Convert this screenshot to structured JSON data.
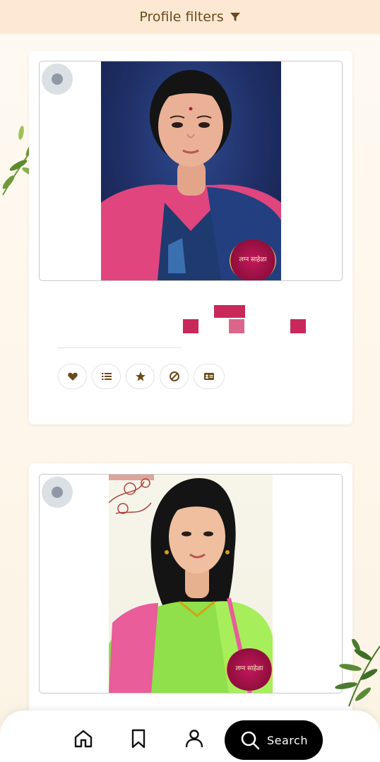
{
  "header": {
    "title": "Profile filters",
    "filter_icon": "funnel-icon"
  },
  "profiles": [
    {
      "badge_text": "लग्न साहेळा"
    },
    {
      "badge_text": "लग्न साहेळा"
    }
  ],
  "actions": [
    {
      "icon": "heart-icon"
    },
    {
      "icon": "list-icon"
    },
    {
      "icon": "star-icon"
    },
    {
      "icon": "block-icon"
    },
    {
      "icon": "id-card-icon"
    }
  ],
  "bottom_nav": {
    "items": [
      {
        "icon": "home-icon"
      },
      {
        "icon": "bookmark-icon"
      },
      {
        "icon": "user-icon"
      }
    ],
    "search_label": "Search"
  },
  "colors": {
    "accent": "#c9285a",
    "header_bg": "#fde9d3",
    "header_text": "#6b4a1a"
  }
}
